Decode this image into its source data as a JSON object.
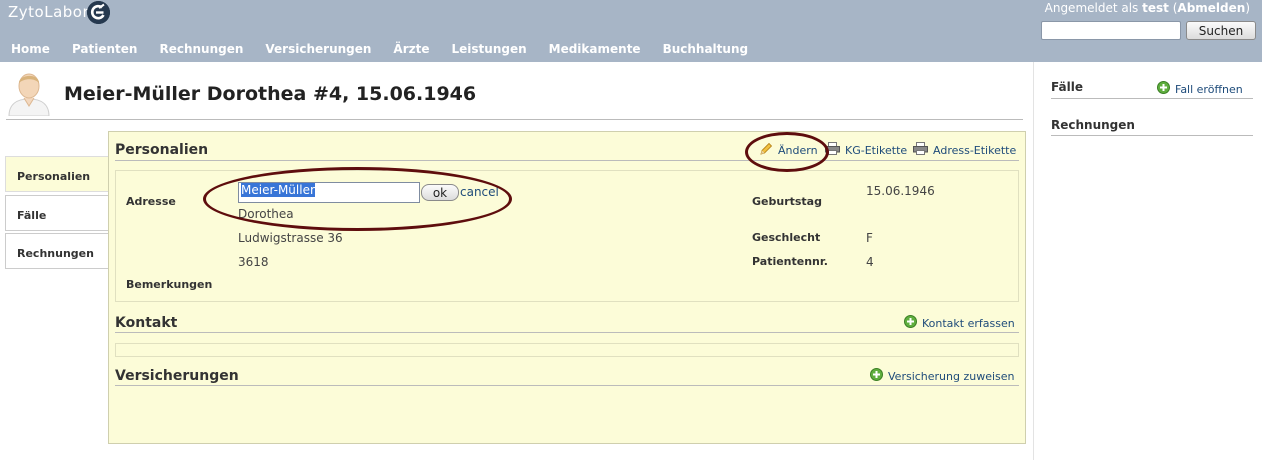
{
  "app": {
    "title": "ZytoLabor"
  },
  "auth": {
    "prefix": "Angemeldet als",
    "user": "test",
    "logout": "Abmelden"
  },
  "search": {
    "button": "Suchen",
    "value": ""
  },
  "nav": [
    "Home",
    "Patienten",
    "Rechnungen",
    "Versicherungen",
    "Ärzte",
    "Leistungen",
    "Medikamente",
    "Buchhaltung"
  ],
  "page": {
    "title": "Meier-Müller Dorothea #4, 15.06.1946"
  },
  "tabs": [
    {
      "label": "Personalien",
      "active": true
    },
    {
      "label": "Fälle",
      "active": false
    },
    {
      "label": "Rechnungen",
      "active": false
    }
  ],
  "personalien": {
    "title": "Personalien",
    "actions": {
      "edit": "Ändern",
      "kg_label": "KG-Etikette",
      "address_label": "Adress-Etikette"
    },
    "address": {
      "label": "Adresse",
      "edit_value": "Meier-Müller",
      "ok": "ok",
      "cancel": "cancel",
      "firstname": "Dorothea",
      "street": "Ludwigstrasse 36",
      "zip": "3618"
    },
    "remarks_label": "Bemerkungen",
    "birthday": {
      "label": "Geburtstag",
      "value": "15.06.1946"
    },
    "sex": {
      "label": "Geschlecht",
      "value": "F"
    },
    "patient_no": {
      "label": "Patientennr.",
      "value": "4"
    }
  },
  "kontakt": {
    "title": "Kontakt",
    "action": "Kontakt erfassen"
  },
  "versicherungen": {
    "title": "Versicherungen",
    "action": "Versicherung zuweisen"
  },
  "sidebar": {
    "faelle": {
      "title": "Fälle",
      "action": "Fall eröffnen"
    },
    "rechnungen": {
      "title": "Rechnungen"
    }
  },
  "colors": {
    "header_bg": "#a7b5c6",
    "panel_bg": "#fcfcd8",
    "link": "#1e4b7a",
    "annotation": "#5e0d0d"
  }
}
